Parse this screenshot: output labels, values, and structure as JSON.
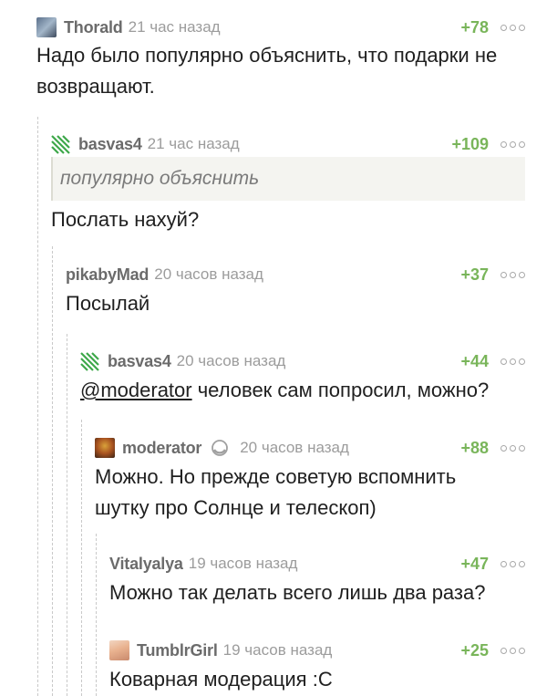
{
  "comments": [
    {
      "user": "Thorald",
      "time": "21 час назад",
      "rating": "+78",
      "text": "Надо было популярно объяснить, что подарки не возвращают."
    },
    {
      "user": "basvas4",
      "time": "21 час назад",
      "rating": "+109",
      "quote": "популярно объяснить",
      "text": "Послать нахуй?"
    },
    {
      "user": "pikabyMad",
      "time": "20 часов назад",
      "rating": "+37",
      "text": "Посылай"
    },
    {
      "user": "basvas4",
      "time": "20 часов назад",
      "rating": "+44",
      "mention": "@moderator",
      "text": " человек сам попросил, можно?"
    },
    {
      "user": "moderator",
      "time": "20 часов назад",
      "rating": "+88",
      "text": "Можно. Но прежде советую вспомнить шутку про Солнце и телескоп)"
    },
    {
      "user": "Vitalyalya",
      "time": "19 часов назад",
      "rating": "+47",
      "text": "Можно так делать всего лишь два раза?"
    },
    {
      "user": "TumblrGirl",
      "time": "19 часов назад",
      "rating": "+25",
      "text": "Коварная модерация :С"
    }
  ]
}
